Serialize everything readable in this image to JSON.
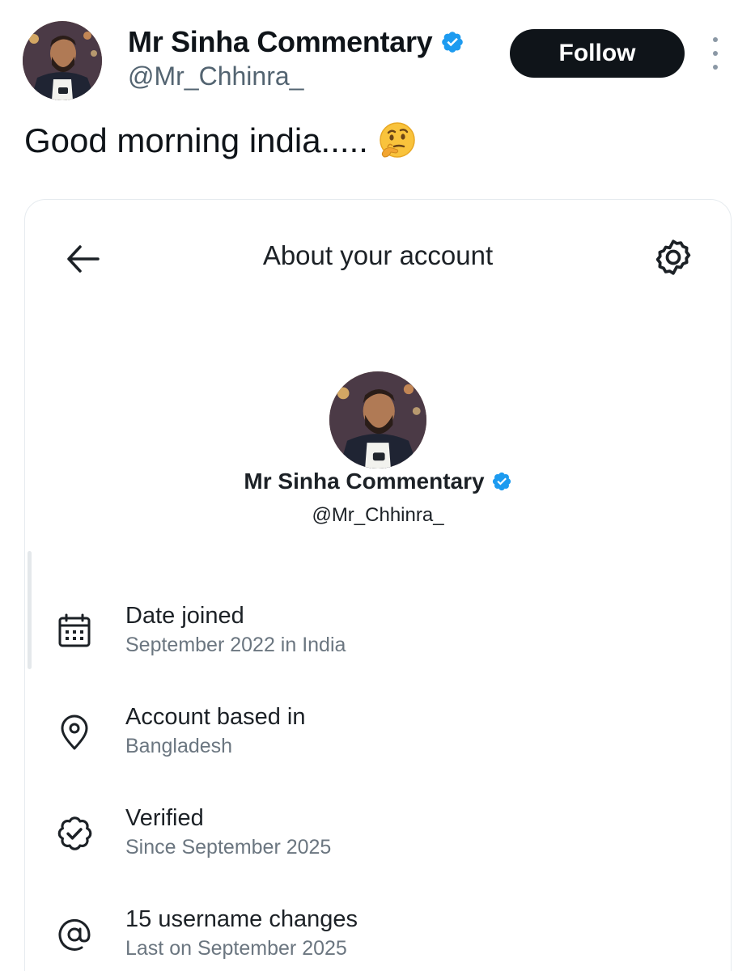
{
  "tweet": {
    "author": {
      "display_name": "Mr Sinha Commentary",
      "handle": "@Mr_Chhinra_",
      "verified": true
    },
    "follow_label": "Follow",
    "text": "Good morning india.....",
    "emoji": "thinking-face"
  },
  "embedded_screenshot": {
    "title": "About your account",
    "profile": {
      "display_name": "Mr Sinha Commentary",
      "handle": "@Mr_Chhinra_",
      "verified": true
    },
    "items": [
      {
        "icon": "calendar-icon",
        "title": "Date joined",
        "subtitle": "September 2022 in India"
      },
      {
        "icon": "location-pin-icon",
        "title": "Account based in",
        "subtitle": "Bangladesh"
      },
      {
        "icon": "verified-check-icon",
        "title": "Verified",
        "subtitle": "Since September 2025"
      },
      {
        "icon": "at-sign-icon",
        "title": "15 username changes",
        "subtitle": "Last on September 2025"
      }
    ]
  },
  "colors": {
    "verified_blue": "#1d9bf0",
    "follow_bg": "#0f1419",
    "secondary_text": "#536471"
  }
}
